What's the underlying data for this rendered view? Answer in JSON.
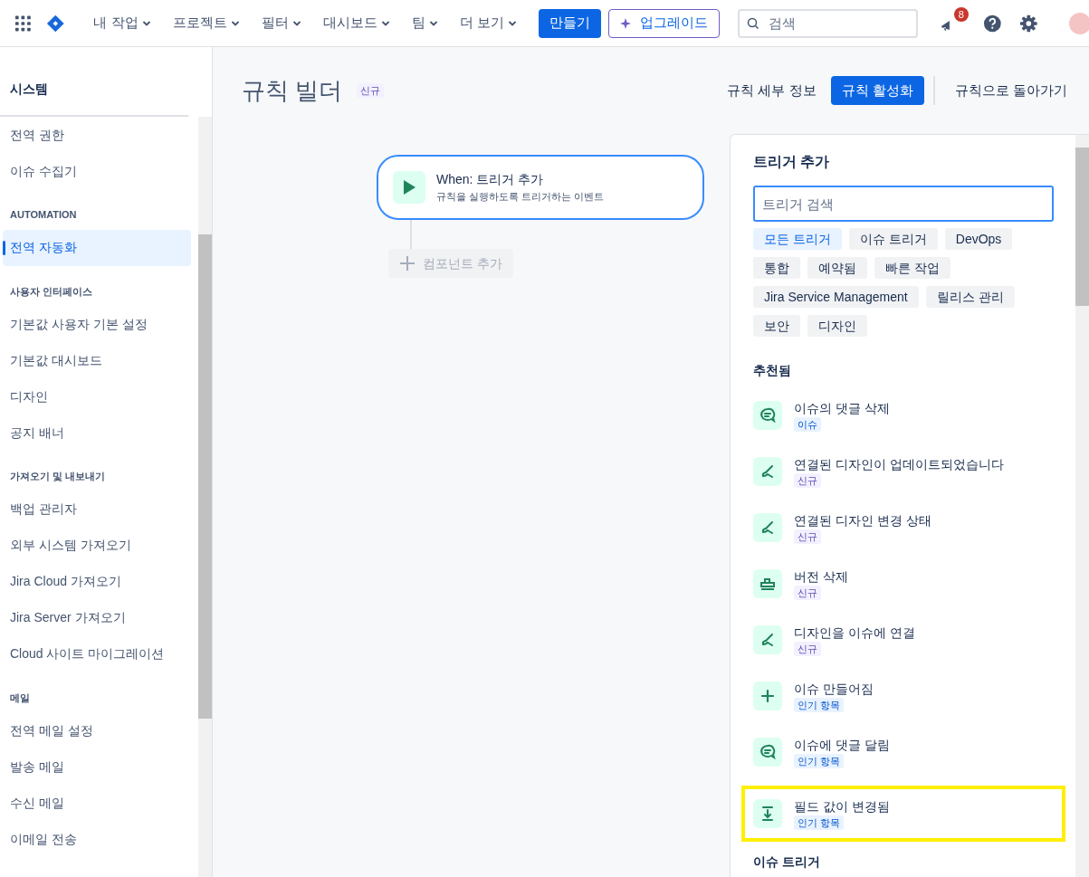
{
  "top_nav": {
    "menus": [
      {
        "label": "내 작업"
      },
      {
        "label": "프로젝트"
      },
      {
        "label": "필터"
      },
      {
        "label": "대시보드"
      },
      {
        "label": "팀"
      },
      {
        "label": "더 보기"
      }
    ],
    "create_button": "만들기",
    "upgrade_button": "업그레이드",
    "search": {
      "placeholder": "검색"
    },
    "notifications_count": "8"
  },
  "sidebar": {
    "title": "시스템",
    "sections": [
      {
        "items": [
          {
            "label": "전역 권한",
            "selected": false
          },
          {
            "label": "이슈 수집기",
            "selected": false
          }
        ]
      },
      {
        "heading": "AUTOMATION",
        "items": [
          {
            "label": "전역 자동화",
            "selected": true
          }
        ]
      },
      {
        "heading": "사용자 인터페이스",
        "items": [
          {
            "label": "기본값 사용자 기본 설정",
            "selected": false
          },
          {
            "label": "기본값 대시보드",
            "selected": false
          },
          {
            "label": "디자인",
            "selected": false
          },
          {
            "label": "공지 배너",
            "selected": false
          }
        ]
      },
      {
        "heading": "가져오기 및 내보내기",
        "items": [
          {
            "label": "백업 관리자",
            "selected": false
          },
          {
            "label": "외부 시스템 가져오기",
            "selected": false
          },
          {
            "label": "Jira Cloud 가져오기",
            "selected": false
          },
          {
            "label": "Jira Server 가져오기",
            "selected": false
          },
          {
            "label": "Cloud 사이트 마이그레이션",
            "selected": false
          }
        ]
      },
      {
        "heading": "메일",
        "items": [
          {
            "label": "전역 메일 설정",
            "selected": false
          },
          {
            "label": "발송 메일",
            "selected": false
          },
          {
            "label": "수신 메일",
            "selected": false
          },
          {
            "label": "이메일 전송",
            "selected": false
          }
        ]
      }
    ]
  },
  "header": {
    "title": "규칙 빌더",
    "badge": "신규",
    "actions": [
      {
        "label": "규칙 세부 정보",
        "kind": "subtle"
      },
      {
        "label": "규칙 활성화",
        "kind": "primary"
      },
      {
        "label": "규칙으로 돌아가기",
        "kind": "subtle"
      }
    ]
  },
  "canvas": {
    "trigger_node": {
      "title": "When: 트리거 추가",
      "subtitle": "규칙을 실행하도록 트리거하는 이벤트"
    },
    "add_component": {
      "label": "컴포넌트 추가",
      "disabled": true
    }
  },
  "panel": {
    "title": "트리거 추가",
    "search": {
      "placeholder": "트리거 검색"
    },
    "filters": [
      {
        "label": "모든 트리거",
        "selected": true
      },
      {
        "label": "이슈 트리거",
        "selected": false
      },
      {
        "label": "DevOps",
        "selected": false
      },
      {
        "label": "통합",
        "selected": false
      },
      {
        "label": "예약됨",
        "selected": false
      },
      {
        "label": "빠른 작업",
        "selected": false
      },
      {
        "label": "Jira Service Management",
        "selected": false
      },
      {
        "label": "릴리스 관리",
        "selected": false
      },
      {
        "label": "보안",
        "selected": false
      },
      {
        "label": "디자인",
        "selected": false
      }
    ],
    "recommended_heading": "추천됨",
    "triggers": [
      {
        "title": "이슈의 댓글 삭제",
        "kind": "comment",
        "tag": {
          "label": "이슈",
          "color": "#e9f2ff"
        },
        "highlighted": false
      },
      {
        "title": "연결된 디자인이 업데이트되었습니다",
        "kind": "design",
        "tag": {
          "label": "신규",
          "color": "#f3f0ff"
        },
        "highlighted": false
      },
      {
        "title": "연결된 디자인 변경 상태",
        "kind": "design",
        "tag": {
          "label": "신규",
          "color": "#f3f0ff"
        },
        "highlighted": false
      },
      {
        "title": "버전 삭제",
        "kind": "version",
        "tag": {
          "label": "신규",
          "color": "#f3f0ff"
        },
        "highlighted": false
      },
      {
        "title": "디자인을 이슈에 연결",
        "kind": "design",
        "tag": {
          "label": "신규",
          "color": "#f3f0ff"
        },
        "highlighted": false
      },
      {
        "title": "이슈 만들어짐",
        "kind": "create",
        "tag": {
          "label": "인기 항목",
          "color": "#e9f2ff"
        },
        "highlighted": false
      },
      {
        "title": "이슈에 댓글 달림",
        "kind": "comment",
        "tag": {
          "label": "인기 항목",
          "color": "#e9f2ff"
        },
        "highlighted": false
      },
      {
        "title": "필드 값이 변경됨",
        "kind": "field",
        "tag": {
          "label": "인기 항목",
          "color": "#e9f2ff"
        },
        "highlighted": true
      }
    ],
    "issue_triggers_heading": "이슈 트리거"
  }
}
